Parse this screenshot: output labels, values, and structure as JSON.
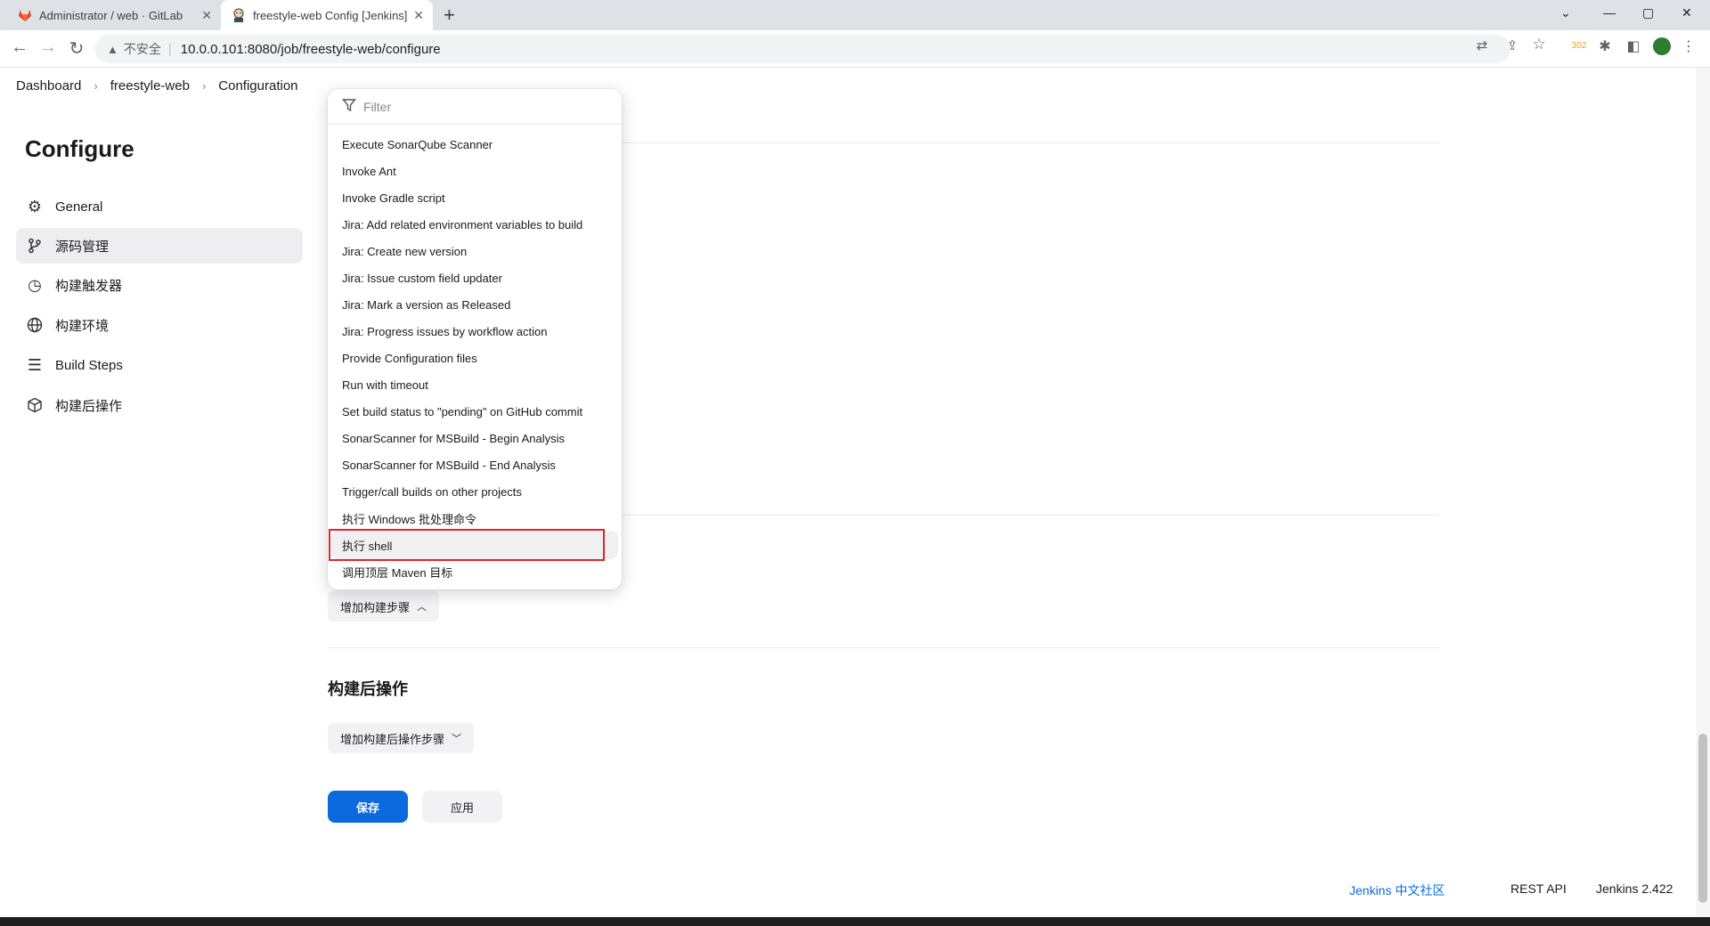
{
  "browser": {
    "tabs": [
      {
        "title": "Administrator / web · GitLab",
        "icon": "gitlab-icon",
        "active": false
      },
      {
        "title": "freestyle-web Config [Jenkins]",
        "icon": "jenkins-icon",
        "active": true
      }
    ],
    "address": {
      "insecure_label": "不安全",
      "url": "10.0.0.101:8080/job/freestyle-web/configure"
    },
    "extension_badge": "302"
  },
  "breadcrumb": [
    "Dashboard",
    "freestyle-web",
    "Configuration"
  ],
  "sidebar": {
    "title": "Configure",
    "items": [
      {
        "label": "General",
        "icon": "gear-icon"
      },
      {
        "label": "源码管理",
        "icon": "branch-icon",
        "active": true
      },
      {
        "label": "构建触发器",
        "icon": "clock-icon"
      },
      {
        "label": "构建环境",
        "icon": "globe-icon"
      },
      {
        "label": "Build Steps",
        "icon": "list-icon"
      },
      {
        "label": "构建后操作",
        "icon": "package-icon"
      }
    ]
  },
  "dropdown": {
    "filter_placeholder": "Filter",
    "items": [
      "Execute SonarQube Scanner",
      "Invoke Ant",
      "Invoke Gradle script",
      "Jira: Add related environment variables to build",
      "Jira: Create new version",
      "Jira: Issue custom field updater",
      "Jira: Mark a version as Released",
      "Jira: Progress issues by workflow action",
      "Provide Configuration files",
      "Run with timeout",
      "Set build status to \"pending\" on GitHub commit",
      "SonarScanner for MSBuild - Begin Analysis",
      "SonarScanner for MSBuild - End Analysis",
      "Trigger/call builds on other projects",
      "执行 Windows 批处理命令",
      "执行 shell",
      "调用顶层 Maven 目标"
    ],
    "highlighted_item": "执行 shell"
  },
  "main": {
    "add_build_step": "增加构建步骤",
    "post_build_title": "构建后操作",
    "add_post_build_step": "增加构建后操作步骤",
    "save": "保存",
    "apply": "应用"
  },
  "footer": {
    "community": "Jenkins 中文社区",
    "rest_api": "REST API",
    "version": "Jenkins 2.422"
  },
  "colors": {
    "primary": "#0b6bde",
    "highlight_border": "#e0262c",
    "link": "#0b6bde"
  }
}
